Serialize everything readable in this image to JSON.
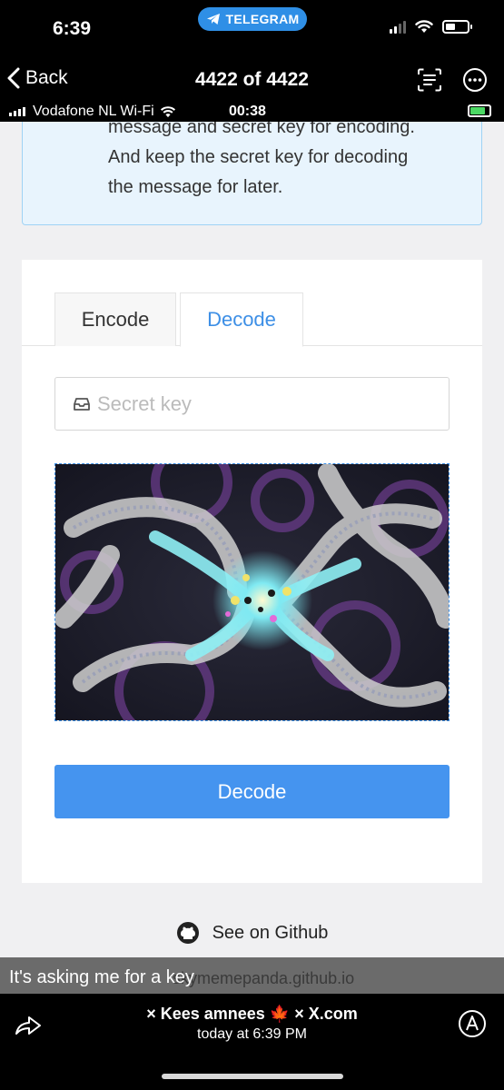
{
  "status_bar": {
    "time": "6:39",
    "telegram_label": "TELEGRAM"
  },
  "viewer": {
    "back_label": "Back",
    "counter": "4422 of 4422"
  },
  "inner_status": {
    "carrier": "Vodafone NL Wi-Fi",
    "time": "00:38"
  },
  "info": {
    "lines": [
      "message and secret key for encoding.",
      "And keep the secret key for decoding",
      "the message for later."
    ]
  },
  "tabs": [
    {
      "label": "Encode",
      "active": false
    },
    {
      "label": "Decode",
      "active": true
    }
  ],
  "key_input": {
    "placeholder": "Secret key",
    "value": ""
  },
  "decode_button": "Decode",
  "github_link": "See on Github",
  "caption": {
    "text": "It's asking me for a key",
    "url_behind": "skymemepanda.github.io"
  },
  "sender": {
    "line": "× Kees amnees 🍁 × X.com",
    "date": "today at 6:39 PM"
  },
  "colors": {
    "accent": "#4594ef",
    "tab_active": "#3d8fe6",
    "info_bg": "#e8f4fd",
    "telegram": "#2f8fe6"
  }
}
